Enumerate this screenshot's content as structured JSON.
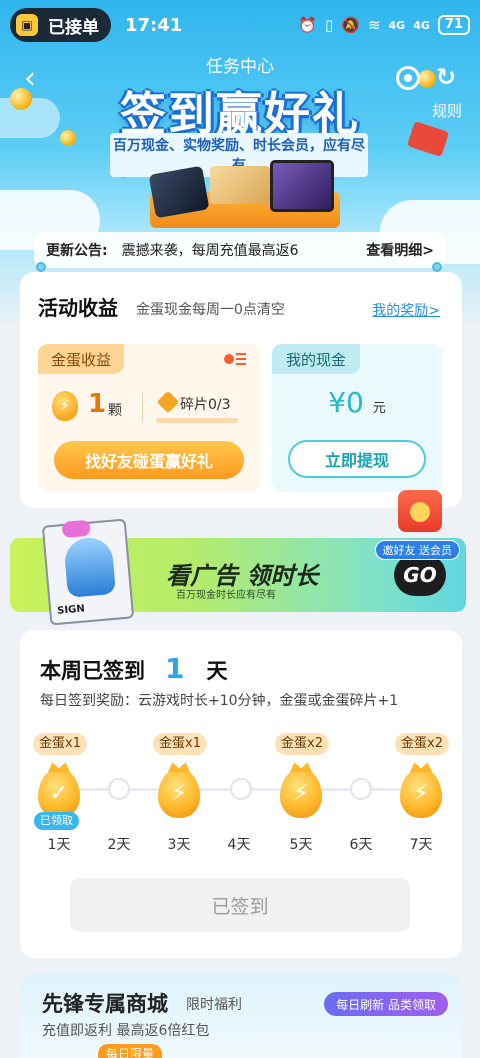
{
  "status_bar": {
    "order_badge": "已接单",
    "time": "17:41",
    "battery": "71",
    "signal_1": "4G",
    "signal_2": "4G"
  },
  "nav": {
    "title": "任务中心",
    "rules_label": "规则"
  },
  "banner": {
    "title": "签到赢好礼",
    "subtitle": "百万现金、实物奖励、时长会员，应有尽有"
  },
  "notice": {
    "label": "更新公告:",
    "text": "震撼来袭，每周充值最高返6",
    "link": "查看明细>"
  },
  "earnings": {
    "title": "活动收益",
    "subtitle": "金蛋现金每周一0点清空",
    "link": "我的奖励>",
    "gold": {
      "tag": "金蛋收益",
      "count": "1",
      "unit": "颗",
      "fragments": "碎片0/3",
      "fragments_progress": 0,
      "button": "找好友碰蛋赢好礼"
    },
    "cash": {
      "tag": "我的现金",
      "amount": "¥0",
      "unit": "元",
      "button": "立即提现"
    }
  },
  "ad": {
    "title": "看广告 领时长",
    "subtitle": "百万现金时长应有尽有",
    "go": "GO",
    "invite": "邀好友 送会员",
    "card_text": "SIGN"
  },
  "checkin": {
    "title_prefix": "本周已签到",
    "days": "1",
    "title_suffix": "天",
    "desc": "每日签到奖励：云游戏时长+10分钟，金蛋或金蛋碎片+1",
    "rewards": [
      "金蛋x1",
      "金蛋x1",
      "金蛋x2",
      "金蛋x2"
    ],
    "claimed_label": "已领取",
    "day_labels": [
      "1天",
      "2天",
      "3天",
      "4天",
      "5天",
      "6天",
      "7天"
    ],
    "button": "已签到"
  },
  "store": {
    "title": "先锋专属商城",
    "tag": "限时福利",
    "subtitle": "充值即返利 最高返6倍红包",
    "refresh": "每日刷新 品类领取",
    "limit": "每日限量"
  },
  "colors": {
    "accent_blue": "#2aa6e8",
    "gold": "#ff9a1e",
    "teal": "#24b8cc"
  }
}
